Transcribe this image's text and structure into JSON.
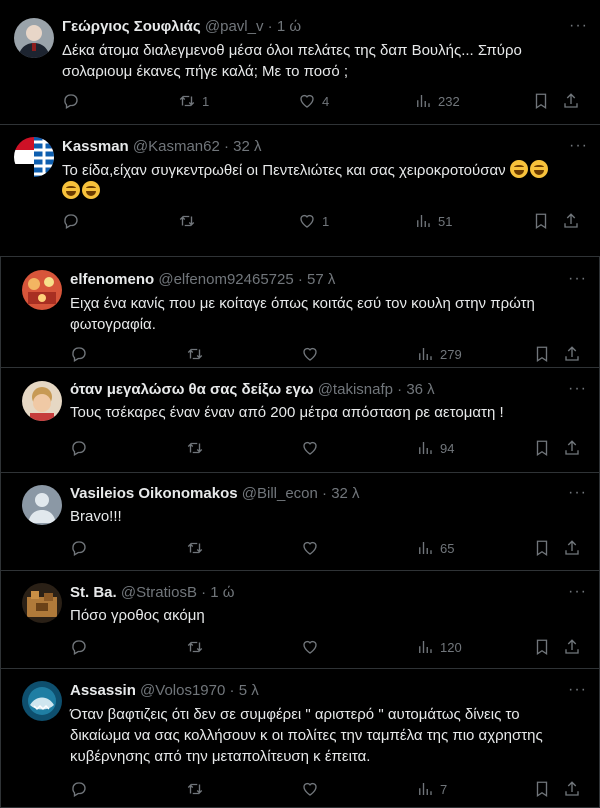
{
  "colors": {
    "background": "#000000",
    "text": "#e7e9ea",
    "muted": "#71767b",
    "divider": "#2f3336"
  },
  "icons": [
    "reply-icon",
    "retweet-icon",
    "like-icon",
    "views-icon",
    "bookmark-icon",
    "share-icon",
    "more-icon",
    "laughing-emoji"
  ],
  "tweets": [
    {
      "name": "Γεώργιος Σουφλιάς",
      "handle": "@pavl_v",
      "dot": "·",
      "time": "1 ώ",
      "more": "···",
      "text": "Δέκα άτομα διαλεγμενοθ μέσα όλοι πελάτες της δαπ Βουλής... Σπύρο σολαριουμ έκανες πήγε καλά; Με το ποσό ;",
      "retweets": "1",
      "likes": "4",
      "views": "232"
    },
    {
      "name": "Kassman",
      "handle": "@Kasman62",
      "dot": "·",
      "time": "32 λ",
      "more": "···",
      "text": "Το είδα,είχαν συγκεντρωθεί οι Πεντελιώτες και σας χειροκροτούσαν",
      "retweets": "",
      "likes": "1",
      "views": "51"
    },
    {
      "name": "elfenomeno",
      "handle": "@elfenom92465725",
      "dot": "·",
      "time": "57 λ",
      "more": "···",
      "text": "Ειχα ένα κανίς που με κοίταγε όπως κοιτάς εσύ τον κουλη στην πρώτη φωτογραφία.",
      "retweets": "",
      "likes": "",
      "views": "279"
    },
    {
      "name": "όταν μεγαλώσω θα σας δείξω εγω",
      "handle": "@takisnafp",
      "dot": "·",
      "time": "36 λ",
      "more": "···",
      "text": "Τους τσέκαρες έναν έναν από 200 μέτρα απόσταση ρε αετοματη !",
      "retweets": "",
      "likes": "",
      "views": "94"
    },
    {
      "name": "Vasileios Oikonomakos",
      "handle": "@Bill_econ",
      "dot": "·",
      "time": "32 λ",
      "more": "···",
      "text": "Bravo!!!",
      "retweets": "",
      "likes": "",
      "views": "65"
    },
    {
      "name": "St. Ba.",
      "handle": "@StratiosB",
      "dot": "·",
      "time": "1 ώ",
      "more": "···",
      "text": "Πόσο γροθος ακόμη",
      "retweets": "",
      "likes": "",
      "views": "120"
    },
    {
      "name": "Assassin",
      "handle": "@Volos1970",
      "dot": "·",
      "time": "5 λ",
      "more": "···",
      "text": "Όταν βαφτιζεις ότι δεν σε συμφέρει \" αριστερό \" αυτομάτως δίνεις το δικαίωμα να σας κολλήσουν κ οι πολίτες την ταμπέλα της πιο αχρηστης κυβέρνησης από την μεταπολίτευση κ έπειτα.",
      "retweets": "",
      "likes": "",
      "views": "7"
    }
  ]
}
